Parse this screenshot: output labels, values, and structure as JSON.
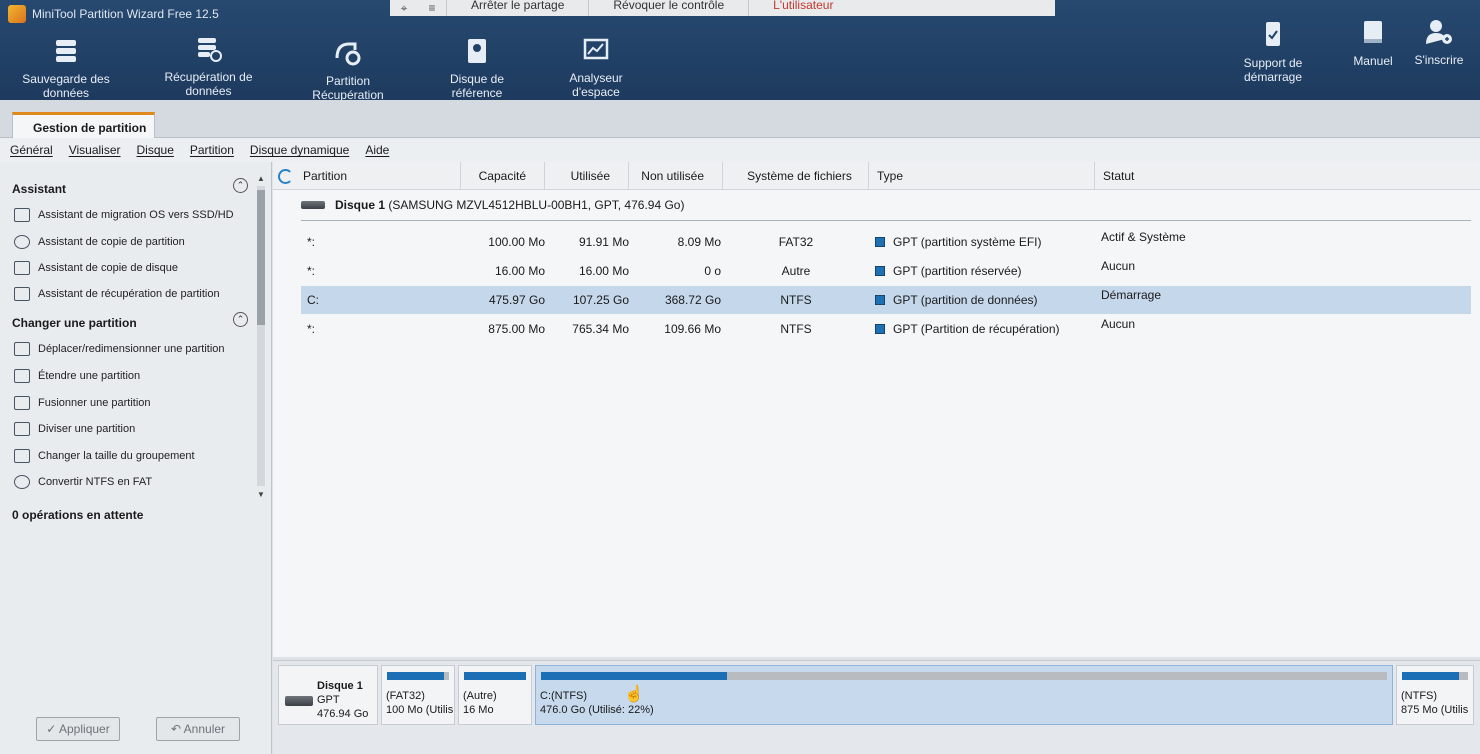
{
  "app": {
    "title": "MiniTool Partition Wizard Free 12.5"
  },
  "share_bar": {
    "stop_share": "Arrêter le partage",
    "revoke": "Révoquer le contrôle",
    "third": "L'utilisateur"
  },
  "toolbar": {
    "items": [
      {
        "label": "Sauvegarde des données",
        "icon": "database-icon"
      },
      {
        "label": "Récupération de données",
        "icon": "data-recovery-icon"
      },
      {
        "label": "Partition Récupération",
        "icon": "partition-recovery-icon"
      },
      {
        "label": "Disque de référence",
        "icon": "disk-benchmark-icon"
      },
      {
        "label": "Analyseur d'espace",
        "icon": "space-analyzer-icon"
      }
    ],
    "right_items": [
      {
        "label": "Support de démarrage",
        "icon": "bootable-media-icon"
      },
      {
        "label": "Manuel",
        "icon": "manual-icon"
      },
      {
        "label": "S'inscrire",
        "icon": "register-icon"
      }
    ]
  },
  "tabs": {
    "active": "Gestion de partition"
  },
  "menu": [
    "Général",
    "Visualiser",
    "Disque",
    "Partition",
    "Disque dynamique",
    "Aide"
  ],
  "sidebar": {
    "assistant_title": "Assistant",
    "assistant_items": [
      "Assistant de migration OS vers SSD/HD",
      "Assistant de copie de partition",
      "Assistant de copie de disque",
      "Assistant de récupération de partition"
    ],
    "change_title": "Changer une partition",
    "change_items": [
      "Déplacer/redimensionner une partition",
      "Étendre une partition",
      "Fusionner une partition",
      "Diviser une partition",
      "Changer la taille du groupement",
      "Convertir NTFS en FAT"
    ],
    "pending": "0 opérations en attente",
    "apply": "✓ Appliquer",
    "undo": "↶ Annuler"
  },
  "table": {
    "headers": [
      "Partition",
      "Capacité",
      "Utilisée",
      "Non utilisée",
      "Système de fichiers",
      "Type",
      "Statut"
    ],
    "disk_label": "Disque 1",
    "disk_detail": "(SAMSUNG MZVL4512HBLU-00BH1, GPT, 476.94 Go)",
    "rows": [
      {
        "partition": "*:",
        "capacity": "100.00 Mo",
        "used": "91.91 Mo",
        "unused": "8.09 Mo",
        "fs": "FAT32",
        "type": "GPT (partition système EFI)",
        "status": "Actif & Système"
      },
      {
        "partition": "*:",
        "capacity": "16.00 Mo",
        "used": "16.00 Mo",
        "unused": "0 o",
        "fs": "Autre",
        "type": "GPT (partition réservée)",
        "status": "Aucun"
      },
      {
        "partition": "C:",
        "capacity": "475.97 Go",
        "used": "107.25 Go",
        "unused": "368.72 Go",
        "fs": "NTFS",
        "type": "GPT (partition de données)",
        "status": "Démarrage"
      },
      {
        "partition": "*:",
        "capacity": "875.00 Mo",
        "used": "765.34 Mo",
        "unused": "109.66 Mo",
        "fs": "NTFS",
        "type": "GPT (Partition de récupération)",
        "status": "Aucun"
      }
    ],
    "selected_row": 2
  },
  "diskmap": {
    "disk": {
      "name": "Disque 1",
      "scheme": "GPT",
      "size": "476.94 Go"
    },
    "parts": [
      {
        "l1": "(FAT32)",
        "l2": "100 Mo (Utilis",
        "used_frac": 0.92
      },
      {
        "l1": "(Autre)",
        "l2": "16 Mo",
        "used_frac": 1.0
      },
      {
        "l1": "C:(NTFS)",
        "l2": "476.0 Go (Utilisé: 22%)",
        "used_frac": 0.22
      },
      {
        "l1": "(NTFS)",
        "l2": "875 Mo (Utilis",
        "used_frac": 0.87
      }
    ]
  }
}
